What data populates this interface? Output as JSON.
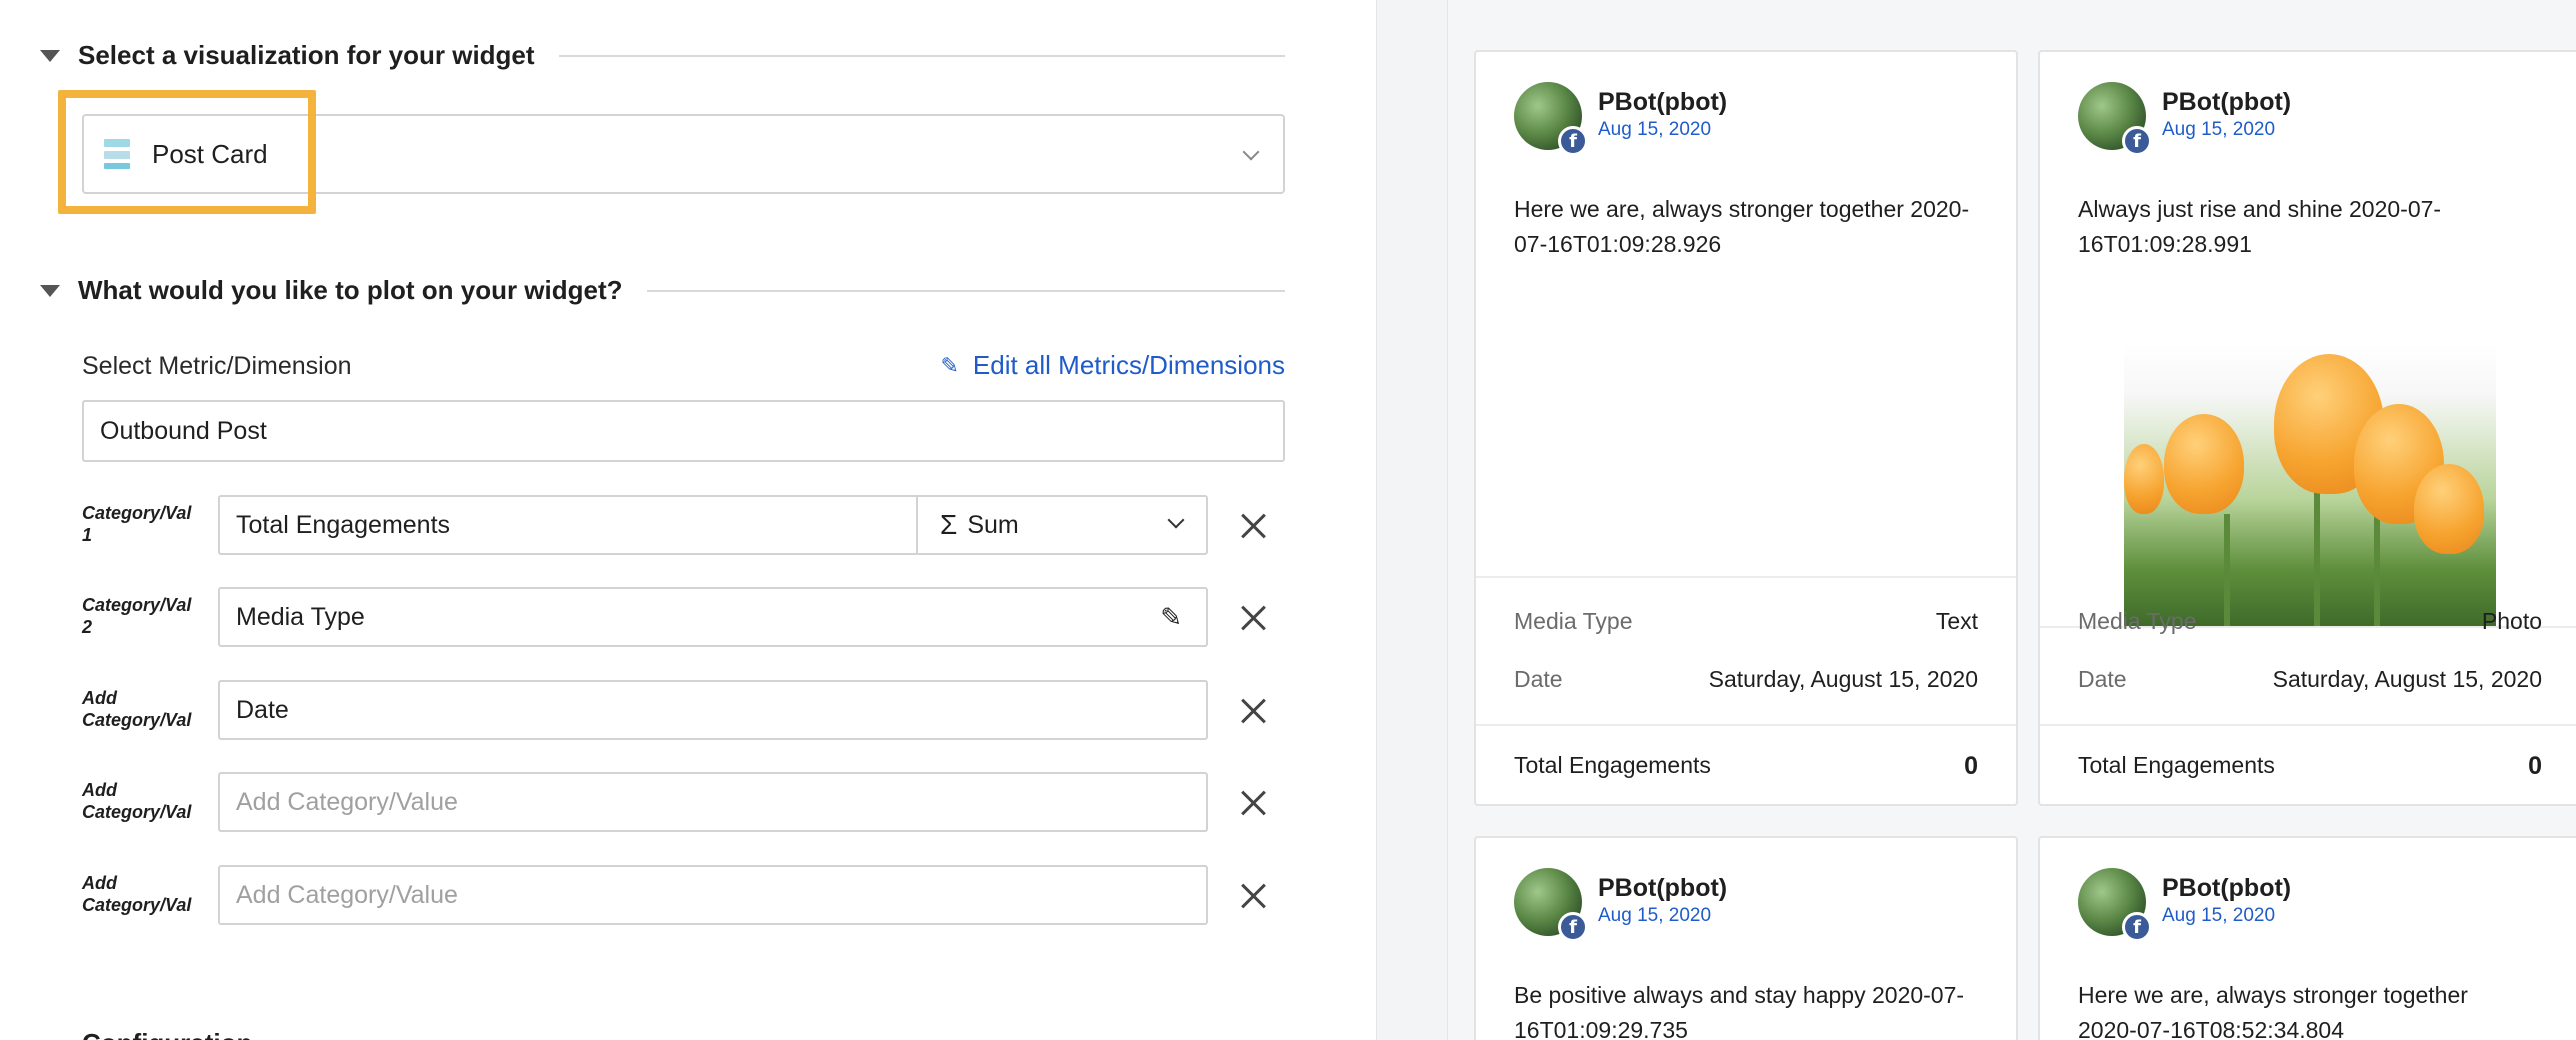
{
  "config": {
    "visualization_section": {
      "title": "Select a visualization for your widget",
      "selected": "Post Card"
    },
    "plot_section": {
      "title": "What would you like to plot on your widget?"
    },
    "metric_label": "Select Metric/Dimension",
    "edit_link": "Edit all Metrics/Dimensions",
    "metric_value": "Outbound Post",
    "rows": [
      {
        "label_line1": "Category/Val",
        "label_line2": "1",
        "value": "Total Engagements",
        "aggregation": "Sum",
        "agg_symbol": "Σ"
      },
      {
        "label_line1": "Category/Val",
        "label_line2": "2",
        "value": "Media Type"
      },
      {
        "label_line1": "Add",
        "label_line2": "Category/Val",
        "value": "Date"
      },
      {
        "label_line1": "Add",
        "label_line2": "Category/Val",
        "placeholder": "Add Category/Value"
      },
      {
        "label_line1": "Add",
        "label_line2": "Category/Val",
        "placeholder": "Add Category/Value"
      }
    ],
    "cutoff_heading": "Configuration"
  },
  "preview": {
    "cards": [
      {
        "author": "PBot(pbot)",
        "date": "Aug 15, 2020",
        "text": "Here we are, always stronger together 2020-07-16T01:09:28.926",
        "media_type_label": "Media Type",
        "media_type": "Text",
        "date_label": "Date",
        "date_value": "Saturday, August 15, 2020",
        "total_label": "Total Engagements",
        "total_value": "0"
      },
      {
        "author": "PBot(pbot)",
        "date": "Aug 15, 2020",
        "text": "Always just rise and shine 2020-07-16T01:09:28.991",
        "media_type_label": "Media Type",
        "media_type": "Photo",
        "date_label": "Date",
        "date_value": "Saturday, August 15, 2020",
        "total_label": "Total Engagements",
        "total_value": "0"
      },
      {
        "author": "PBot(pbot)",
        "date": "Aug 15, 2020",
        "text": "Be positive always and stay happy 2020-07-16T01:09:29.735"
      },
      {
        "author": "PBot(pbot)",
        "date": "Aug 15, 2020",
        "text": "Here we are, always stronger together 2020-07-16T08:52:34.804"
      }
    ]
  },
  "icons": {
    "collapse": "triangle-down-icon",
    "post_card": "post-card-icon",
    "edit": "pencil-icon",
    "remove": "close-icon",
    "facebook": "facebook-icon"
  },
  "colors": {
    "highlight": "#f3b33d",
    "link": "#1f5cc9",
    "facebook": "#3a5a98"
  }
}
